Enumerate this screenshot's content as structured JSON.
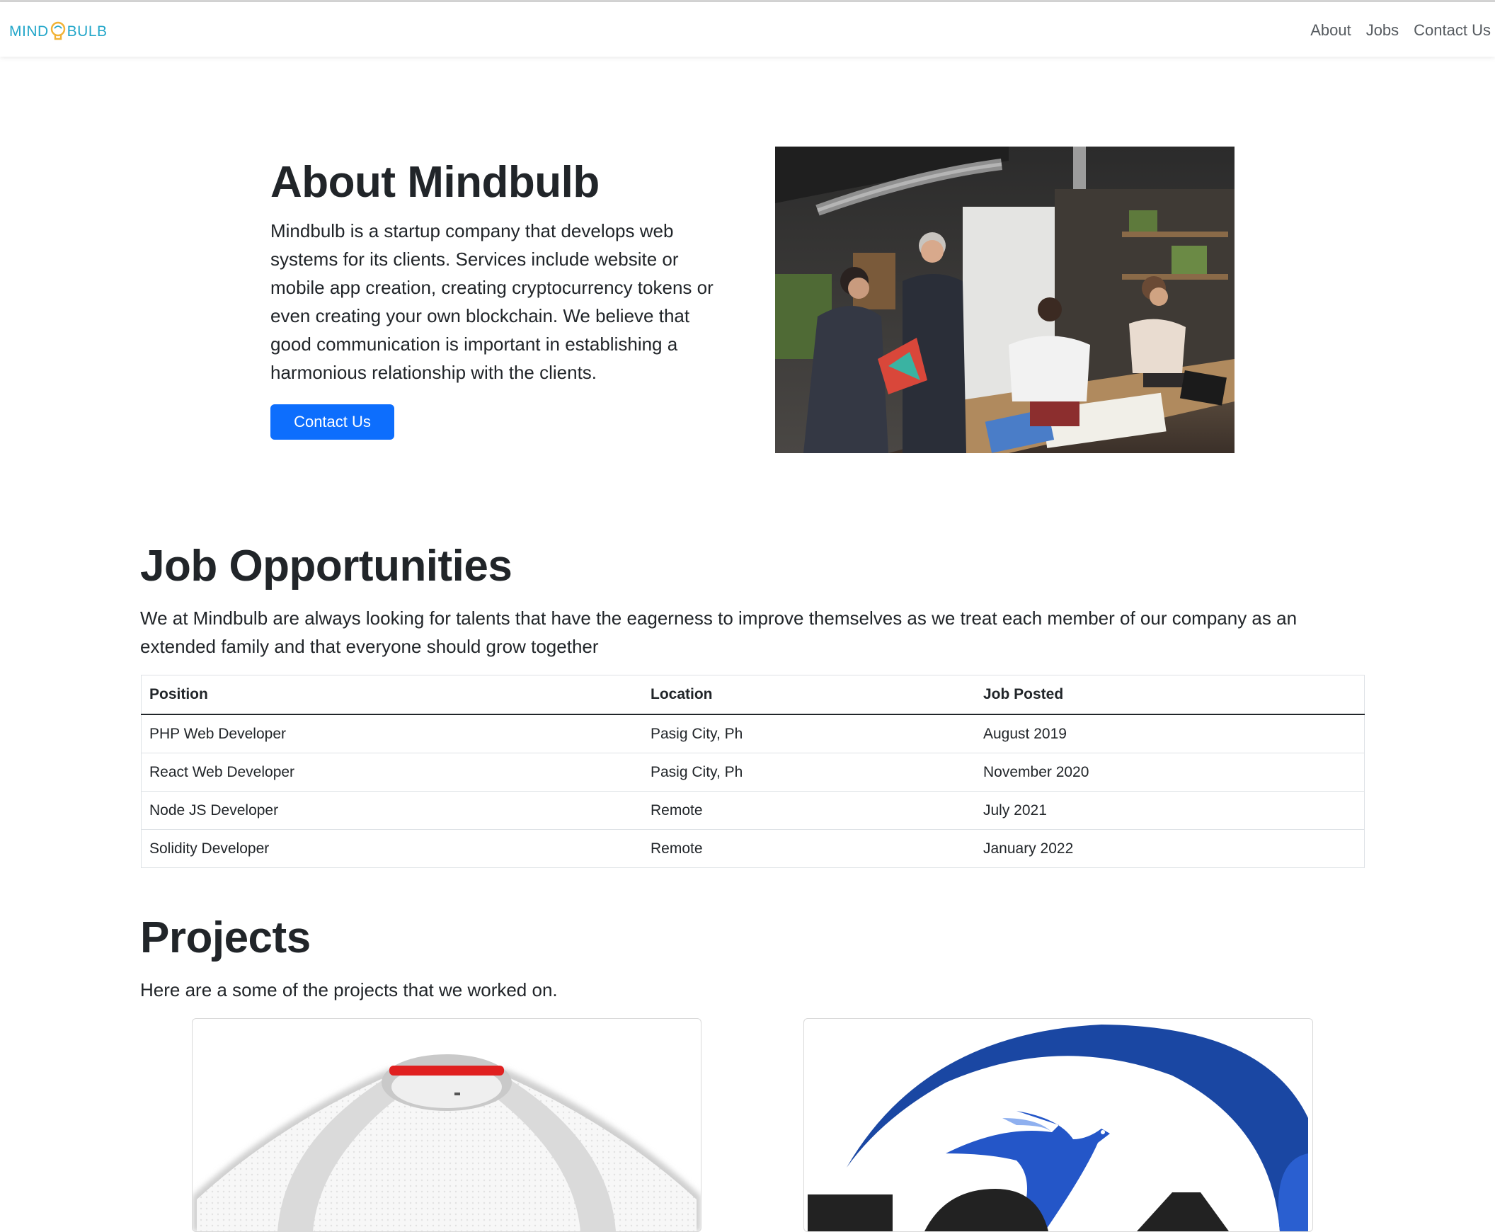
{
  "brand": {
    "logo_part1": "MIND",
    "logo_part2": "BULB"
  },
  "nav": {
    "links": [
      "About",
      "Jobs",
      "Contact Us"
    ]
  },
  "about": {
    "title": "About Mindbulb",
    "text": "Mindbulb is a startup company that develops web systems for its clients. Services include website or mobile app creation, creating cryptocurrency tokens or even creating your own blockchain. We believe that good communication is important in establishing a harmonious relationship with the clients.",
    "button_label": "Contact Us"
  },
  "jobs": {
    "title": "Job Opportunities",
    "description": "We at Mindbulb are always looking for talents that have the eagerness to improve themselves as we treat each member of our company as an extended family and that everyone should grow together",
    "headers": [
      "Position",
      "Location",
      "Job Posted"
    ],
    "rows": [
      [
        "PHP Web Developer",
        "Pasig City, Ph",
        "August 2019"
      ],
      [
        "React Web Developer",
        "Pasig City, Ph",
        "November 2020"
      ],
      [
        "Node JS Developer",
        "Remote",
        "July 2021"
      ],
      [
        "Solidity Developer",
        "Remote",
        "January 2022"
      ]
    ]
  },
  "projects": {
    "title": "Projects",
    "description": "Here are a some of the projects that we worked on."
  },
  "colors": {
    "primary": "#0d6efd",
    "brand": "#22a6c9",
    "text": "#212529"
  }
}
